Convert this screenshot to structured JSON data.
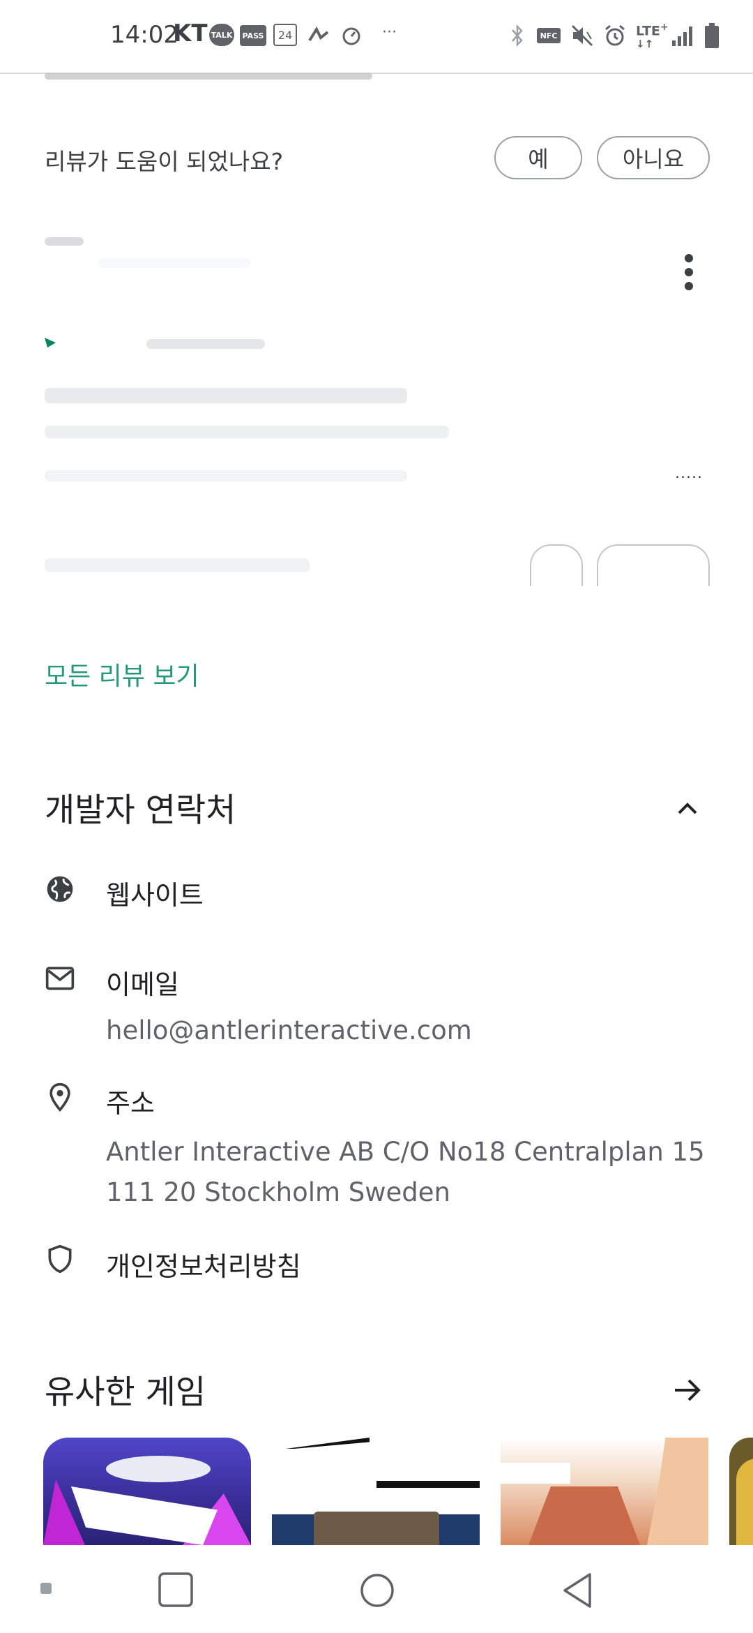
{
  "status_bar": {
    "time": "14:02",
    "carrier": "KT",
    "badges": [
      "TALK",
      "PASS",
      "24"
    ],
    "right_icons": [
      "bluetooth-icon",
      "nfc-icon",
      "mute-icon",
      "alarm-icon",
      "lte-icon",
      "signal-icon",
      "battery-icon"
    ]
  },
  "review_feedback": {
    "question": "리뷰가 도움이 되었나요?",
    "yes_label": "예",
    "no_label": "아니요"
  },
  "see_all_reviews": "모든 리뷰 보기",
  "developer_contact": {
    "title": "개발자 연락처",
    "website_label": "웹사이트",
    "email_label": "이메일",
    "email_value": "hello@antlerinteractive.com",
    "address_label": "주소",
    "address_line1": "Antler Interactive AB C/O No18 Centralplan 15",
    "address_line2": "111 20 Stockholm Sweden",
    "privacy_label": "개인정보처리방침"
  },
  "similar_games": {
    "title": "유사한 게임"
  },
  "colors": {
    "accent_green": "#01875f",
    "text_primary": "#202124",
    "text_secondary": "#5f6368"
  }
}
